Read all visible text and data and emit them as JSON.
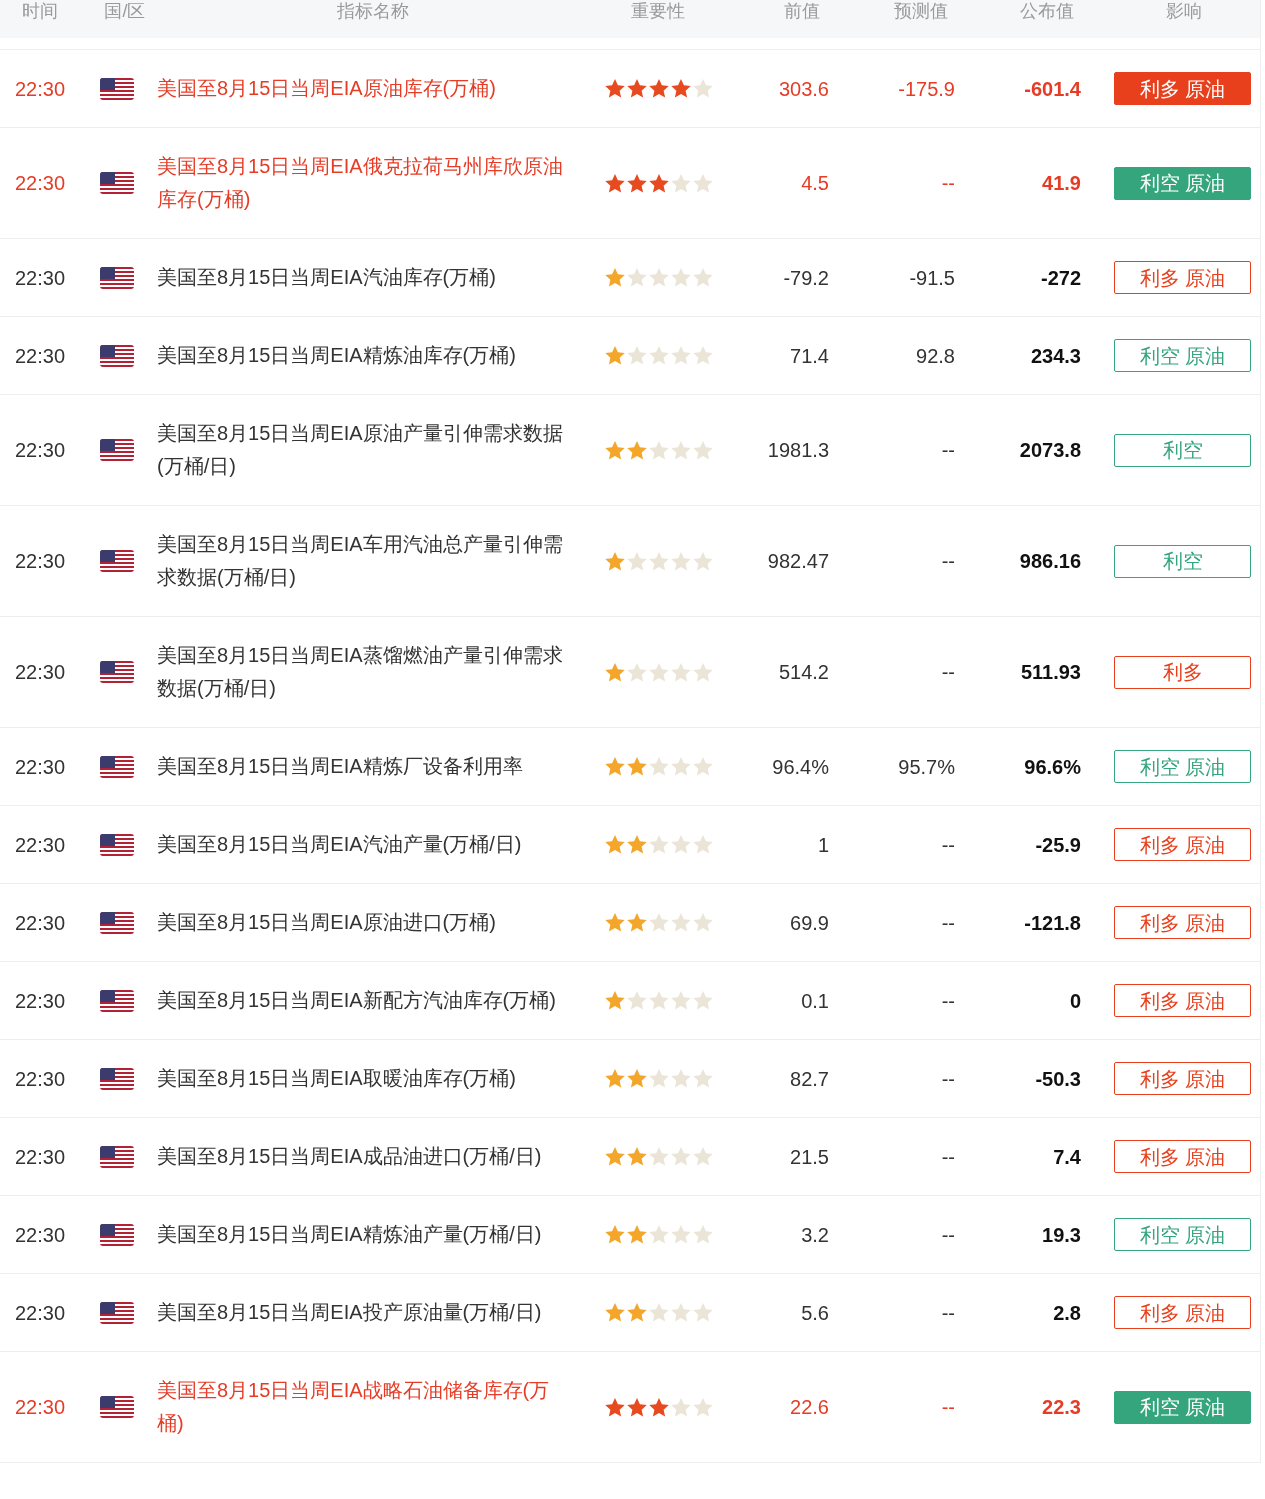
{
  "columns": [
    "时间",
    "国/区",
    "指标名称",
    "重要性",
    "前值",
    "预测值",
    "公布值",
    "影响"
  ],
  "rows": [
    {
      "time": "22:30",
      "name": "美国至8月15日当周EIA原油库存(万桶)",
      "stars": 4,
      "previous": "303.6",
      "forecast": "-175.9",
      "actual": "-601.4",
      "highlighted": true,
      "impact": {
        "kind": "bullish",
        "label": "利多 原油"
      }
    },
    {
      "time": "22:30",
      "name": "美国至8月15日当周EIA俄克拉荷马州库欣原油库存(万桶)",
      "stars": 3,
      "previous": "4.5",
      "forecast": "--",
      "actual": "41.9",
      "highlighted": true,
      "impact": {
        "kind": "bearish",
        "label": "利空 原油"
      }
    },
    {
      "time": "22:30",
      "name": "美国至8月15日当周EIA汽油库存(万桶)",
      "stars": 1,
      "previous": "-79.2",
      "forecast": "-91.5",
      "actual": "-272",
      "highlighted": false,
      "impact": {
        "kind": "bullish",
        "label": "利多 原油"
      }
    },
    {
      "time": "22:30",
      "name": "美国至8月15日当周EIA精炼油库存(万桶)",
      "stars": 1,
      "previous": "71.4",
      "forecast": "92.8",
      "actual": "234.3",
      "highlighted": false,
      "impact": {
        "kind": "bearish",
        "label": "利空 原油"
      }
    },
    {
      "time": "22:30",
      "name": "美国至8月15日当周EIA原油产量引伸需求数据(万桶/日)",
      "stars": 2,
      "previous": "1981.3",
      "forecast": "--",
      "actual": "2073.8",
      "highlighted": false,
      "impact": {
        "kind": "bearish",
        "label": "利空"
      }
    },
    {
      "time": "22:30",
      "name": "美国至8月15日当周EIA车用汽油总产量引伸需求数据(万桶/日)",
      "stars": 1,
      "previous": "982.47",
      "forecast": "--",
      "actual": "986.16",
      "highlighted": false,
      "impact": {
        "kind": "bearish",
        "label": "利空"
      }
    },
    {
      "time": "22:30",
      "name": "美国至8月15日当周EIA蒸馏燃油产量引伸需求数据(万桶/日)",
      "stars": 1,
      "previous": "514.2",
      "forecast": "--",
      "actual": "511.93",
      "highlighted": false,
      "impact": {
        "kind": "bullish",
        "label": "利多"
      }
    },
    {
      "time": "22:30",
      "name": "美国至8月15日当周EIA精炼厂设备利用率",
      "stars": 2,
      "previous": "96.4%",
      "forecast": "95.7%",
      "actual": "96.6%",
      "highlighted": false,
      "impact": {
        "kind": "bearish",
        "label": "利空 原油"
      }
    },
    {
      "time": "22:30",
      "name": "美国至8月15日当周EIA汽油产量(万桶/日)",
      "stars": 2,
      "previous": "1",
      "forecast": "--",
      "actual": "-25.9",
      "highlighted": false,
      "impact": {
        "kind": "bullish",
        "label": "利多 原油"
      }
    },
    {
      "time": "22:30",
      "name": "美国至8月15日当周EIA原油进口(万桶)",
      "stars": 2,
      "previous": "69.9",
      "forecast": "--",
      "actual": "-121.8",
      "highlighted": false,
      "impact": {
        "kind": "bullish",
        "label": "利多 原油"
      }
    },
    {
      "time": "22:30",
      "name": "美国至8月15日当周EIA新配方汽油库存(万桶)",
      "stars": 1,
      "previous": "0.1",
      "forecast": "--",
      "actual": "0",
      "highlighted": false,
      "impact": {
        "kind": "bullish",
        "label": "利多 原油"
      }
    },
    {
      "time": "22:30",
      "name": "美国至8月15日当周EIA取暖油库存(万桶)",
      "stars": 2,
      "previous": "82.7",
      "forecast": "--",
      "actual": "-50.3",
      "highlighted": false,
      "impact": {
        "kind": "bullish",
        "label": "利多 原油"
      }
    },
    {
      "time": "22:30",
      "name": "美国至8月15日当周EIA成品油进口(万桶/日)",
      "stars": 2,
      "previous": "21.5",
      "forecast": "--",
      "actual": "7.4",
      "highlighted": false,
      "impact": {
        "kind": "bullish",
        "label": "利多 原油"
      }
    },
    {
      "time": "22:30",
      "name": "美国至8月15日当周EIA精炼油产量(万桶/日)",
      "stars": 2,
      "previous": "3.2",
      "forecast": "--",
      "actual": "19.3",
      "highlighted": false,
      "impact": {
        "kind": "bearish",
        "label": "利空 原油"
      }
    },
    {
      "time": "22:30",
      "name": "美国至8月15日当周EIA投产原油量(万桶/日)",
      "stars": 2,
      "previous": "5.6",
      "forecast": "--",
      "actual": "2.8",
      "highlighted": false,
      "impact": {
        "kind": "bullish",
        "label": "利多 原油"
      }
    },
    {
      "time": "22:30",
      "name": "美国至8月15日当周EIA战略石油储备库存(万桶)",
      "stars": 3,
      "previous": "22.6",
      "forecast": "--",
      "actual": "22.3",
      "highlighted": true,
      "impact": {
        "kind": "bearish",
        "label": "利空 原油"
      }
    }
  ]
}
